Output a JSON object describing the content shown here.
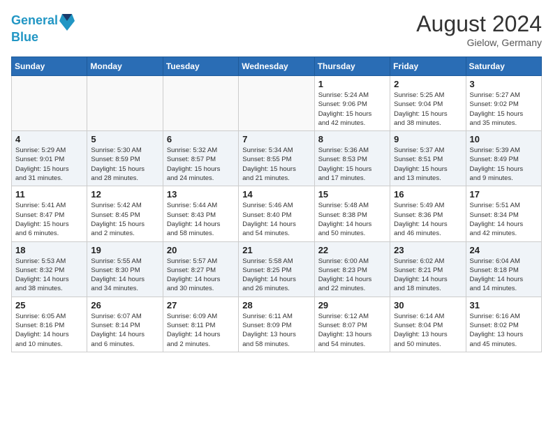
{
  "header": {
    "logo_line1": "General",
    "logo_line2": "Blue",
    "month_year": "August 2024",
    "location": "Gielow, Germany"
  },
  "weekdays": [
    "Sunday",
    "Monday",
    "Tuesday",
    "Wednesday",
    "Thursday",
    "Friday",
    "Saturday"
  ],
  "weeks": [
    [
      {
        "day": "",
        "info": ""
      },
      {
        "day": "",
        "info": ""
      },
      {
        "day": "",
        "info": ""
      },
      {
        "day": "",
        "info": ""
      },
      {
        "day": "1",
        "info": "Sunrise: 5:24 AM\nSunset: 9:06 PM\nDaylight: 15 hours\nand 42 minutes."
      },
      {
        "day": "2",
        "info": "Sunrise: 5:25 AM\nSunset: 9:04 PM\nDaylight: 15 hours\nand 38 minutes."
      },
      {
        "day": "3",
        "info": "Sunrise: 5:27 AM\nSunset: 9:02 PM\nDaylight: 15 hours\nand 35 minutes."
      }
    ],
    [
      {
        "day": "4",
        "info": "Sunrise: 5:29 AM\nSunset: 9:01 PM\nDaylight: 15 hours\nand 31 minutes."
      },
      {
        "day": "5",
        "info": "Sunrise: 5:30 AM\nSunset: 8:59 PM\nDaylight: 15 hours\nand 28 minutes."
      },
      {
        "day": "6",
        "info": "Sunrise: 5:32 AM\nSunset: 8:57 PM\nDaylight: 15 hours\nand 24 minutes."
      },
      {
        "day": "7",
        "info": "Sunrise: 5:34 AM\nSunset: 8:55 PM\nDaylight: 15 hours\nand 21 minutes."
      },
      {
        "day": "8",
        "info": "Sunrise: 5:36 AM\nSunset: 8:53 PM\nDaylight: 15 hours\nand 17 minutes."
      },
      {
        "day": "9",
        "info": "Sunrise: 5:37 AM\nSunset: 8:51 PM\nDaylight: 15 hours\nand 13 minutes."
      },
      {
        "day": "10",
        "info": "Sunrise: 5:39 AM\nSunset: 8:49 PM\nDaylight: 15 hours\nand 9 minutes."
      }
    ],
    [
      {
        "day": "11",
        "info": "Sunrise: 5:41 AM\nSunset: 8:47 PM\nDaylight: 15 hours\nand 6 minutes."
      },
      {
        "day": "12",
        "info": "Sunrise: 5:42 AM\nSunset: 8:45 PM\nDaylight: 15 hours\nand 2 minutes."
      },
      {
        "day": "13",
        "info": "Sunrise: 5:44 AM\nSunset: 8:43 PM\nDaylight: 14 hours\nand 58 minutes."
      },
      {
        "day": "14",
        "info": "Sunrise: 5:46 AM\nSunset: 8:40 PM\nDaylight: 14 hours\nand 54 minutes."
      },
      {
        "day": "15",
        "info": "Sunrise: 5:48 AM\nSunset: 8:38 PM\nDaylight: 14 hours\nand 50 minutes."
      },
      {
        "day": "16",
        "info": "Sunrise: 5:49 AM\nSunset: 8:36 PM\nDaylight: 14 hours\nand 46 minutes."
      },
      {
        "day": "17",
        "info": "Sunrise: 5:51 AM\nSunset: 8:34 PM\nDaylight: 14 hours\nand 42 minutes."
      }
    ],
    [
      {
        "day": "18",
        "info": "Sunrise: 5:53 AM\nSunset: 8:32 PM\nDaylight: 14 hours\nand 38 minutes."
      },
      {
        "day": "19",
        "info": "Sunrise: 5:55 AM\nSunset: 8:30 PM\nDaylight: 14 hours\nand 34 minutes."
      },
      {
        "day": "20",
        "info": "Sunrise: 5:57 AM\nSunset: 8:27 PM\nDaylight: 14 hours\nand 30 minutes."
      },
      {
        "day": "21",
        "info": "Sunrise: 5:58 AM\nSunset: 8:25 PM\nDaylight: 14 hours\nand 26 minutes."
      },
      {
        "day": "22",
        "info": "Sunrise: 6:00 AM\nSunset: 8:23 PM\nDaylight: 14 hours\nand 22 minutes."
      },
      {
        "day": "23",
        "info": "Sunrise: 6:02 AM\nSunset: 8:21 PM\nDaylight: 14 hours\nand 18 minutes."
      },
      {
        "day": "24",
        "info": "Sunrise: 6:04 AM\nSunset: 8:18 PM\nDaylight: 14 hours\nand 14 minutes."
      }
    ],
    [
      {
        "day": "25",
        "info": "Sunrise: 6:05 AM\nSunset: 8:16 PM\nDaylight: 14 hours\nand 10 minutes."
      },
      {
        "day": "26",
        "info": "Sunrise: 6:07 AM\nSunset: 8:14 PM\nDaylight: 14 hours\nand 6 minutes."
      },
      {
        "day": "27",
        "info": "Sunrise: 6:09 AM\nSunset: 8:11 PM\nDaylight: 14 hours\nand 2 minutes."
      },
      {
        "day": "28",
        "info": "Sunrise: 6:11 AM\nSunset: 8:09 PM\nDaylight: 13 hours\nand 58 minutes."
      },
      {
        "day": "29",
        "info": "Sunrise: 6:12 AM\nSunset: 8:07 PM\nDaylight: 13 hours\nand 54 minutes."
      },
      {
        "day": "30",
        "info": "Sunrise: 6:14 AM\nSunset: 8:04 PM\nDaylight: 13 hours\nand 50 minutes."
      },
      {
        "day": "31",
        "info": "Sunrise: 6:16 AM\nSunset: 8:02 PM\nDaylight: 13 hours\nand 45 minutes."
      }
    ]
  ]
}
